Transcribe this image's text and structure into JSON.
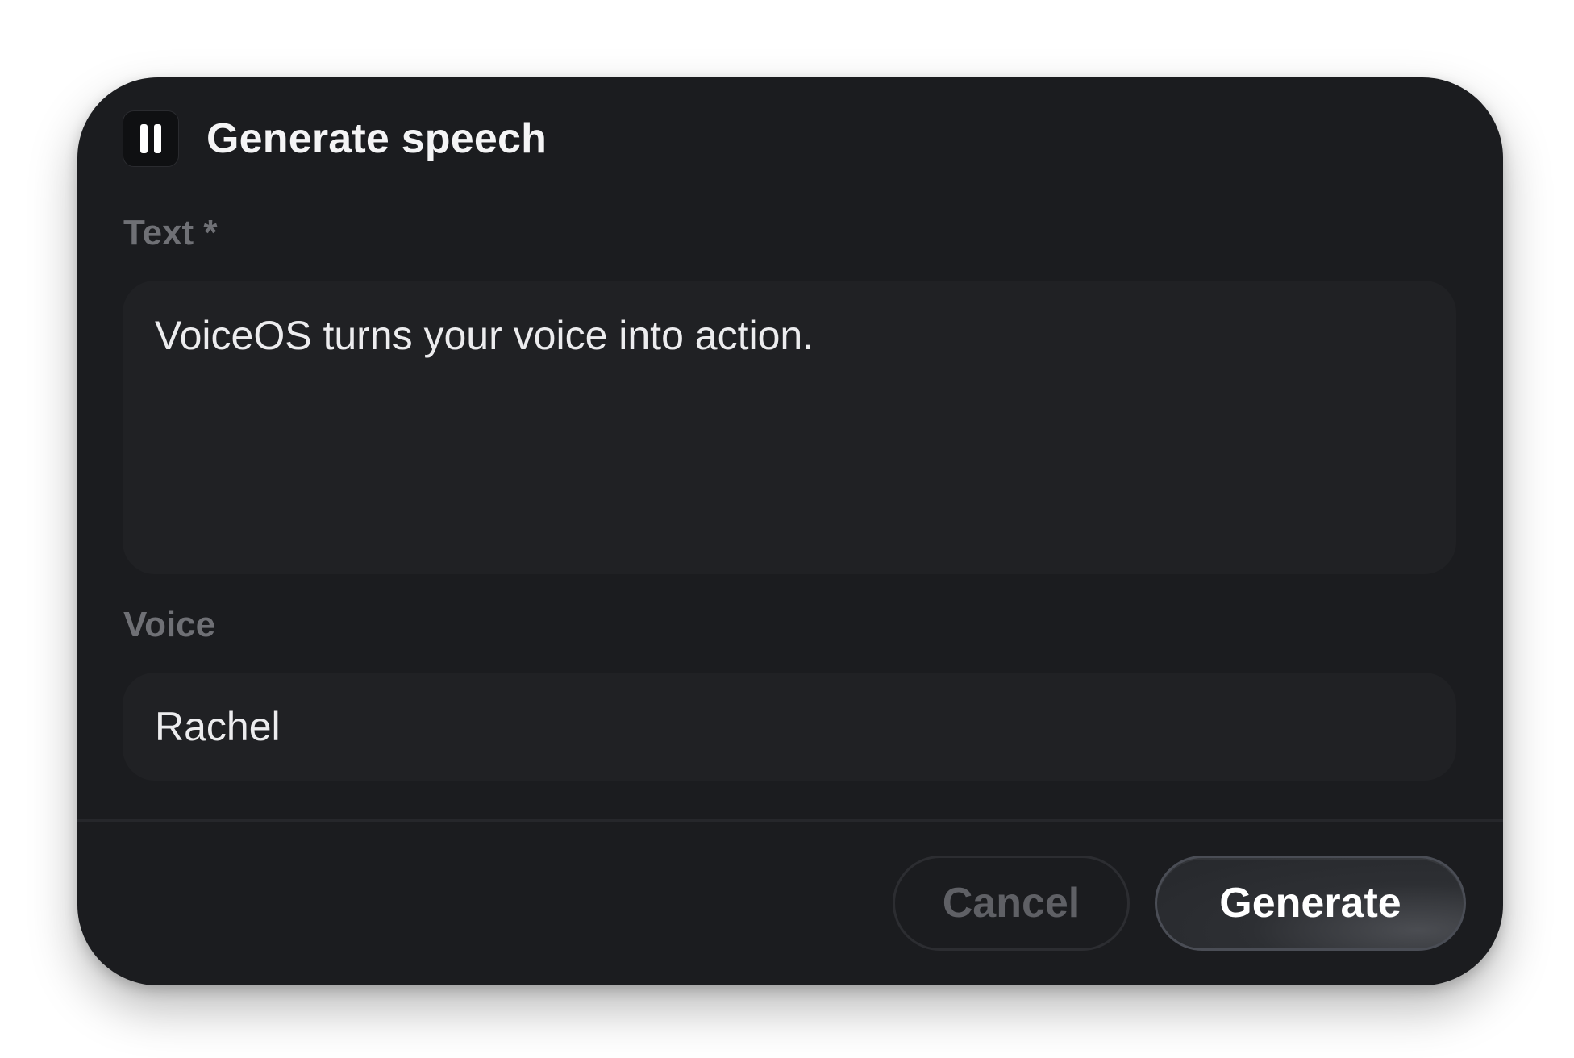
{
  "dialog": {
    "title": "Generate speech",
    "icon": "pause-icon"
  },
  "fields": {
    "text": {
      "label": "Text *",
      "value": "VoiceOS turns your voice into action."
    },
    "voice": {
      "label": "Voice",
      "value": "Rachel"
    }
  },
  "actions": {
    "cancel_label": "Cancel",
    "generate_label": "Generate"
  }
}
